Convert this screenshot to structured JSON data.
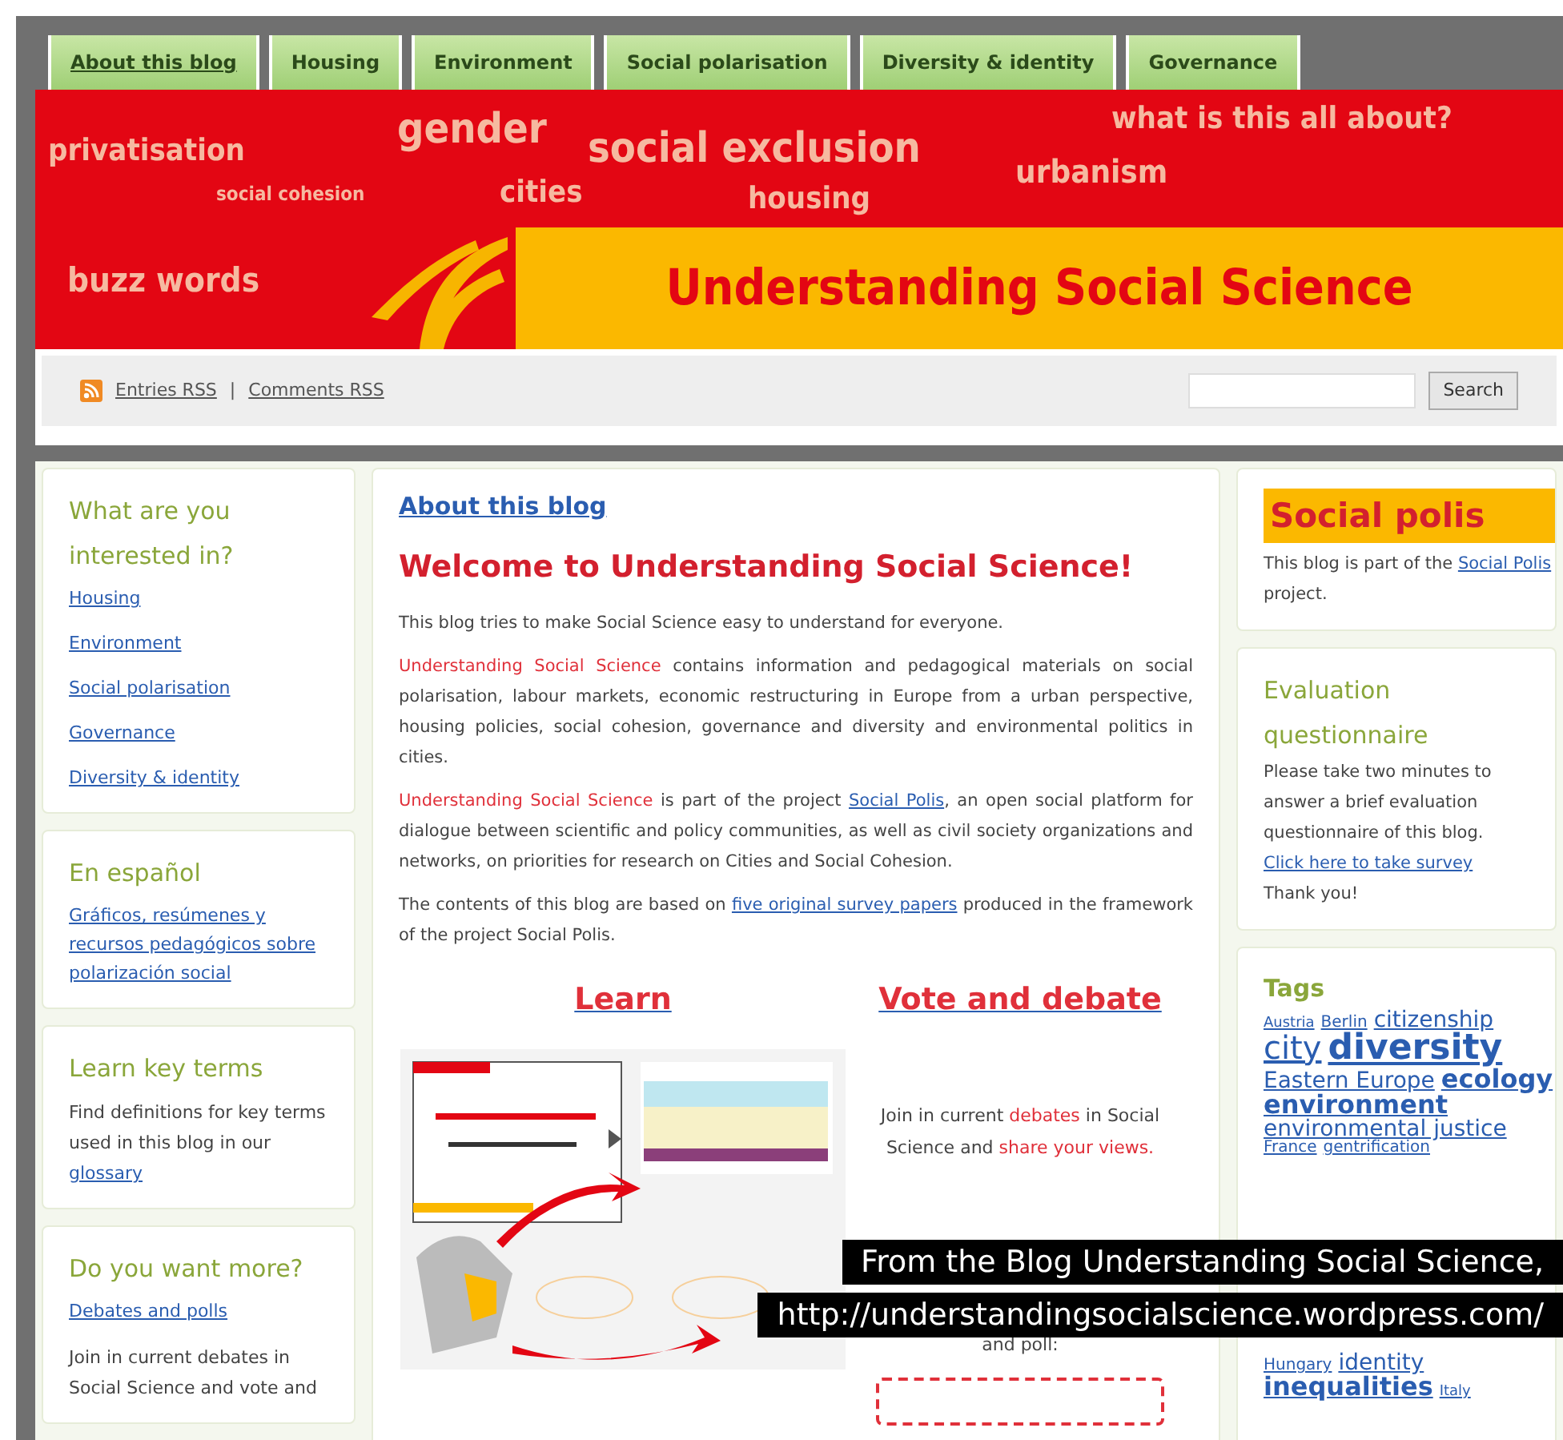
{
  "nav_tabs": [
    {
      "label": "About this blog",
      "selected": true
    },
    {
      "label": "Housing",
      "selected": false
    },
    {
      "label": "Environment",
      "selected": false
    },
    {
      "label": "Social polarisation",
      "selected": false
    },
    {
      "label": "Diversity & identity",
      "selected": false
    },
    {
      "label": "Governance",
      "selected": false
    }
  ],
  "banner": {
    "words": [
      "privatisation",
      "gender",
      "social exclusion",
      "what is this all about?",
      "social cohesion",
      "cities",
      "housing",
      "urbanism",
      "buzz words"
    ],
    "title": "Understanding Social Science"
  },
  "feeds": {
    "entries": "Entries RSS",
    "separator": "|",
    "comments": "Comments RSS"
  },
  "search": {
    "button": "Search"
  },
  "left_sidebar": [
    {
      "title": "What are you interested in?",
      "links": [
        "Housing",
        "Environment",
        "Social polarisation",
        "Governance",
        "Diversity & identity"
      ]
    },
    {
      "title": "En español",
      "links": [
        "Gráficos, resúmenes y recursos pedagógicos sobre polarización social"
      ]
    },
    {
      "title": "Learn key terms",
      "text": "Find definitions for key terms used in this blog in our",
      "link": "glossary"
    },
    {
      "title": "Do you want more?",
      "links": [
        "Debates and polls"
      ],
      "text": "Join in current debates in Social Science and vote and"
    }
  ],
  "post": {
    "breadcrumb": "About this blog",
    "heading": "Welcome to Understanding Social Science!",
    "paragraphs": [
      [
        {
          "t": "This blog tries to make Social Science easy to understand for everyone."
        }
      ],
      [
        {
          "t": "Understanding Social Science",
          "kind": "highlight"
        },
        {
          "t": " contains information and pedagogical materials on social polarisation, labour markets, economic restructuring in Europe from a urban perspective, housing policies, social cohesion, governance and diversity and environmental politics in cities."
        }
      ],
      [
        {
          "t": "Understanding Social Science",
          "kind": "highlight"
        },
        {
          "t": " is part of the project "
        },
        {
          "t": "Social Polis",
          "kind": "link"
        },
        {
          "t": ", an open social platform for dialogue between scientific and policy communities, as well as civil society organizations and networks, on priorities for research on Cities and Social Cohesion."
        }
      ],
      [
        {
          "t": "The contents of this blog are based on "
        },
        {
          "t": "five original survey papers",
          "kind": "link"
        },
        {
          "t": " produced in the framework of the project Social Polis."
        }
      ]
    ],
    "learn": {
      "title": "Learn"
    },
    "vote": {
      "title": "Vote and debate",
      "text": [
        {
          "t": "Join in current "
        },
        {
          "t": "debates",
          "kind": "highlight"
        },
        {
          "t": " in Social Science and "
        },
        {
          "t": "share your views.",
          "kind": "highlight"
        }
      ],
      "tail": "and poll:"
    }
  },
  "right_sidebar": {
    "logo": "Social polis",
    "logo_text": "This blog is part of the ",
    "logo_link": "Social Polis",
    "logo_after": " project.",
    "survey": {
      "title": "Evaluation questionnaire",
      "text": "Please take two minutes to answer a brief evaluation questionnaire of this blog.",
      "link": "Click here to take survey",
      "thanks": "Thank you!"
    },
    "tags": {
      "title": "Tags",
      "items": [
        {
          "label": "Austria",
          "kind": "xs"
        },
        {
          "label": "Berlin",
          "kind": "sm"
        },
        {
          "label": "citizenship",
          "kind": "md"
        },
        {
          "label": "city",
          "kind": "lg"
        },
        {
          "label": "diversity",
          "kind": "xl"
        },
        {
          "label": "Eastern Europe",
          "kind": "md"
        },
        {
          "label": "ecology",
          "kind": "lgb"
        },
        {
          "label": "environment",
          "kind": "lgb"
        },
        {
          "label": "environmental justice",
          "kind": "md"
        },
        {
          "label": "France",
          "kind": "sm"
        },
        {
          "label": "gentrification",
          "kind": "sm"
        }
      ],
      "more": [
        {
          "label": "Hungary",
          "kind": "sm"
        },
        {
          "label": "identity",
          "kind": "md"
        },
        {
          "label": "inequalities",
          "kind": "lgb"
        },
        {
          "label": "Italy",
          "kind": "xs"
        }
      ]
    }
  },
  "caption": [
    "From the Blog Understanding Social Science,",
    "http://understandingsocialscience.wordpress.com/"
  ]
}
